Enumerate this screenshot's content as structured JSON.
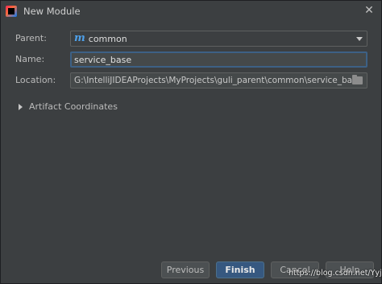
{
  "window": {
    "title": "New Module",
    "close_glyph": "✕"
  },
  "form": {
    "parent_label": "Parent:",
    "parent_icon_glyph": "m",
    "parent_value": "common",
    "name_label": "Name:",
    "name_value": "service_base",
    "location_label": "Location:",
    "location_value": "G:\\IntelliJIDEAProjects\\MyProjects\\guli_parent\\common\\service_base"
  },
  "artifact": {
    "label": "Artifact Coordinates",
    "expanded": false
  },
  "buttons": {
    "previous": "Previous",
    "finish": "Finish",
    "cancel": "Cancel",
    "help": "Help"
  },
  "watermark": "https://blog.csdn.net/YyjYsj",
  "colors": {
    "background": "#3c3f41",
    "primary_button": "#365880",
    "focus_border": "#3d6185",
    "module_icon": "#4ea0e9"
  }
}
